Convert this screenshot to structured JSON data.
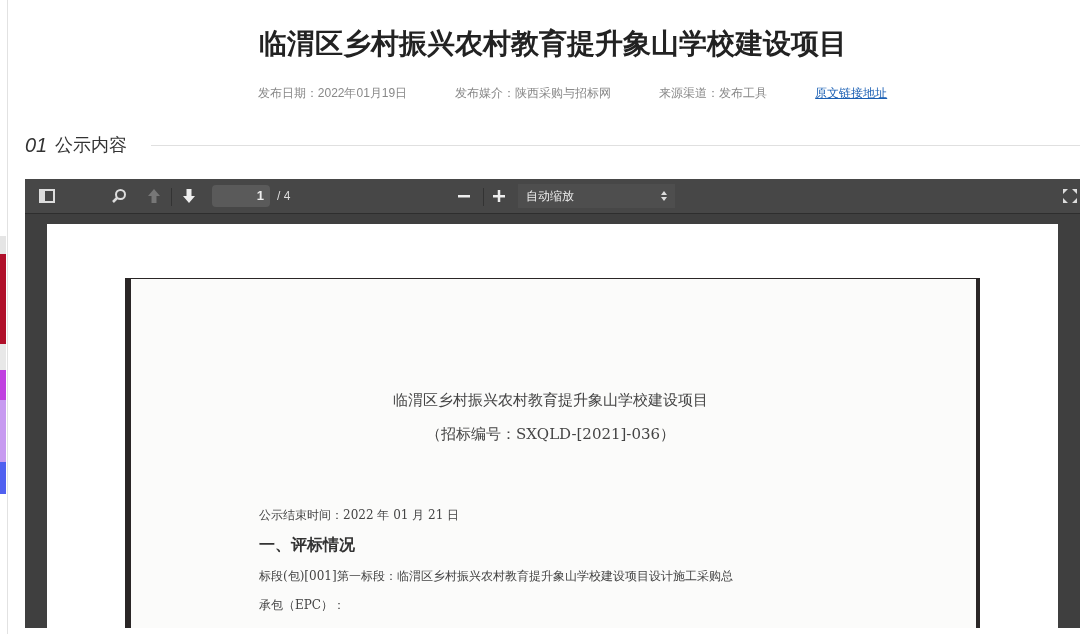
{
  "article": {
    "title": "临渭区乡村振兴农村教育提升象山学校建设项目",
    "meta": [
      {
        "label": "发布日期：",
        "value": "2022年01月19日"
      },
      {
        "label": "发布媒介：",
        "value": "陕西采购与招标网"
      },
      {
        "label": "来源渠道：",
        "value": "发布工具"
      }
    ],
    "source_link": "原文链接地址"
  },
  "section": {
    "number": "01",
    "label": "公示内容"
  },
  "pdf_viewer": {
    "page_number": "1",
    "page_total": "/ 4",
    "zoom": "自动缩放",
    "document": [
      {
        "kind": "title",
        "text": "临渭区乡村振兴农村教育提升象山学校建设项目"
      },
      {
        "kind": "subtitle",
        "text": "（招标编号：SXQLD-[2021]-036）"
      },
      {
        "kind": "line",
        "text": "公示结束时间：2022 年 01 月 21 日"
      },
      {
        "kind": "heading",
        "text": "一、评标情况"
      },
      {
        "kind": "line",
        "text": "标段(包)[001]第一标段：临渭区乡村振兴农村教育提升象山学校建设项目设计施工采购总"
      },
      {
        "kind": "line",
        "text": "承包（EPC）："
      }
    ]
  }
}
